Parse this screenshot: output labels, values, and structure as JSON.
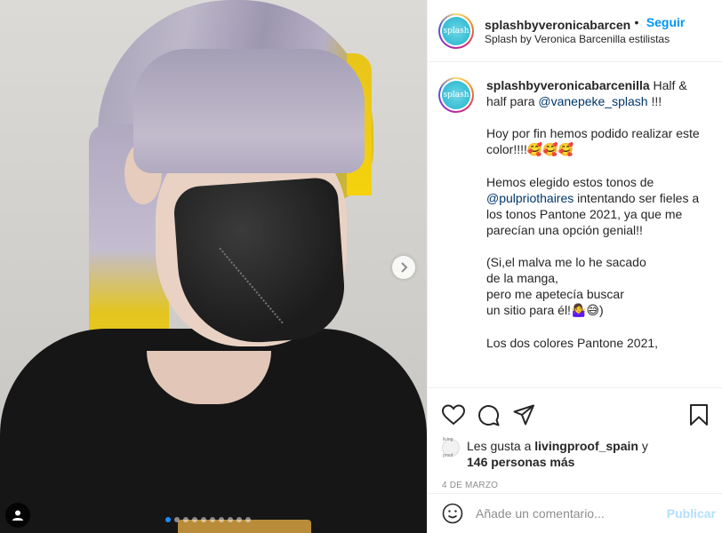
{
  "post": {
    "username": "splashbyveronicabarcenilla",
    "username_truncated": "splashbyveronicabarcenilla",
    "follow_label": "Seguir",
    "bullet": "•",
    "subtitle": "Splash by Veronica Barcenilla estilistas",
    "avatar_text": "splash"
  },
  "caption": {
    "line1_text": "Half & half para",
    "mention1": "@vanepeke_splash",
    "line1_suffix": "!!!",
    "para2": "Hoy por fin hemos podido realizar este color!!!!",
    "para2_emoji": "🥰🥰🥰",
    "para3_prefix": "Hemos elegido estos tonos de",
    "mention2": "@pulpriothaires",
    "para3_suffix": "intentando ser fieles a los tonos Pantone 2021, ya que me parecían una opción genial!!",
    "para4_l1": "(Si,el malva me lo he sacado",
    "para4_l2": "de la manga,",
    "para4_l3": "pero me apetecía buscar",
    "para4_l4": "un sitio para él!",
    "para4_emoji": "🤷‍♀️😅",
    "para4_close": ")",
    "para5": "Los dos colores Pantone 2021,"
  },
  "engagement": {
    "likes_prefix": "Les gusta a",
    "liker": "livingproof_spain",
    "likes_and": "y",
    "others": "146 personas más",
    "liker_avatar_text": "living proof",
    "date": "4 DE MARZO"
  },
  "comment": {
    "placeholder": "Añade un comentario...",
    "publish_label": "Publicar"
  },
  "carousel": {
    "total_slides": 10,
    "active_index": 0
  },
  "colors": {
    "accent": "#0095f6",
    "publish_disabled": "#b2dffc",
    "text": "#262626",
    "muted": "#8e8e8e",
    "mention": "#00376b"
  }
}
